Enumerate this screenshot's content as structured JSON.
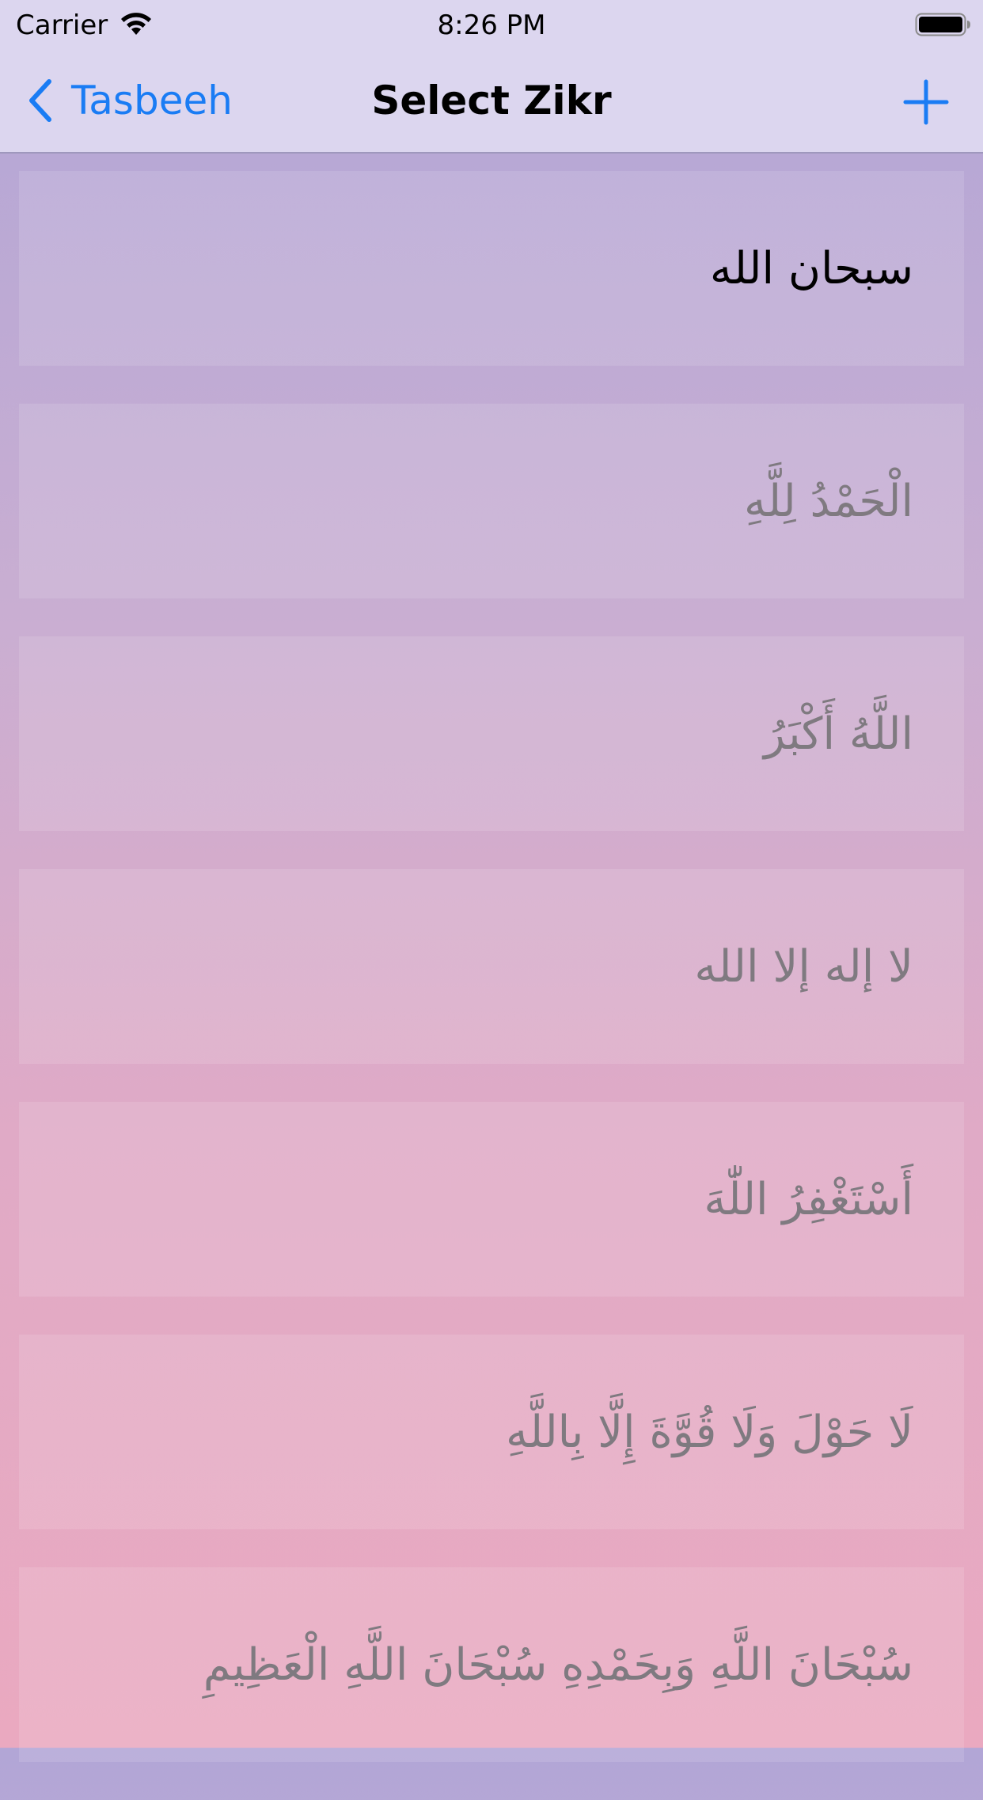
{
  "status_bar": {
    "carrier": "Carrier",
    "time": "8:26 PM"
  },
  "nav": {
    "back_label": "Tasbeeh",
    "title": "Select Zikr",
    "accent_color": "#1a7cf4"
  },
  "zikr_items": [
    {
      "text": "سبحان الله",
      "selected": true
    },
    {
      "text": "الْحَمْدُ لِلَّهِ",
      "selected": false
    },
    {
      "text": "اللَّهُ أَكْبَرُ",
      "selected": false
    },
    {
      "text": "لا إله إلا الله",
      "selected": false
    },
    {
      "text": "أَسْتَغْفِرُ اللّٰهَ",
      "selected": false
    },
    {
      "text": "لَا حَوْلَ وَلَا قُوَّةَ إِلَّا بِاللَّهِ",
      "selected": false
    },
    {
      "text": "سُبْحَانَ اللَّهِ وَبِحَمْدِهِ سُبْحَانَ اللَّهِ الْعَظِيمِ",
      "selected": false
    }
  ]
}
